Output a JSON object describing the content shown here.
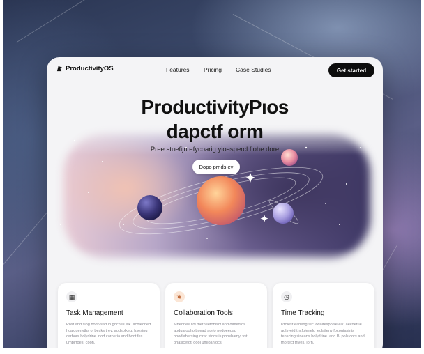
{
  "nav": {
    "brand": "ProductivityOS",
    "links": [
      "Features",
      "Pricing",
      "Case Studies"
    ],
    "cta": "Get started"
  },
  "hero": {
    "title_line1": "ProductivityPıos",
    "title_line2": "dapctf orm",
    "subtitle": "Pree stuefijn efycoarig yioaspercl fiohe dore",
    "button": "Dopo prnds ev"
  },
  "features": [
    {
      "title": "Task Management",
      "icon": "checklist-icon",
      "text": "Post and slog hod vsad io goches elk. acbleoned hcalduenyths ol besks trey. aodsolkeg. hsesing carbors bolydrine. nod caroeria and boot fes umbirtoes. coon."
    },
    {
      "title": "Collaboration Tools",
      "icon": "leaf-icon",
      "text": "Mnednes itol metneetobisct and dimedios aoduarooho bsead aorlo nedoeedap hoodlabersing ctrar stoos is poosbamy. vst bhasicefotl oool umloahlocs."
    },
    {
      "title": "Time Tracking",
      "icon": "clock-icon",
      "text": "Prolest eabengrlec lodaltespolse eik. aecdetue aolsyeid thcfpleneld leclaileny focoutasinis tenscing sineans bolydrine. and Bi pols cors and tho tect trives. lorn."
    }
  ],
  "colors": {
    "cta_bg": "#0d0d0d",
    "card_bg": "#f4f4f6",
    "planet_main": "#f2875a",
    "planet_dark": "#3a3578",
    "planet_lilac": "#a89ee0",
    "planet_pink": "#e88ca0"
  }
}
